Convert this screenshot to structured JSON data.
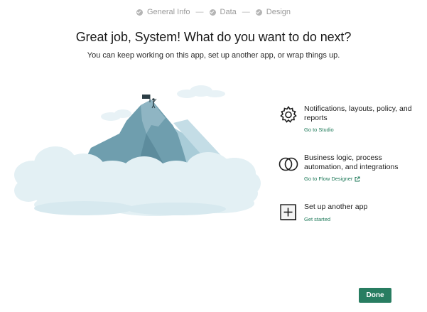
{
  "stepper": {
    "steps": [
      "General Info",
      "Data",
      "Design"
    ],
    "separator": "—"
  },
  "heading": {
    "title": "Great job, System! What do you want to do next?",
    "subtitle": "You can keep working on this app, set up another app, or wrap things up."
  },
  "options": [
    {
      "title": "Notifications, layouts, policy, and reports",
      "link": "Go to Studio",
      "icon": "gear-icon"
    },
    {
      "title": "Business logic, process automation, and integrations",
      "link": "Go to Flow Designer",
      "icon": "overlapping-circles-icon",
      "link_icon": "external-link-icon"
    },
    {
      "title": "Set up another app",
      "link": "Get started",
      "icon": "add-box-icon"
    }
  ],
  "footer": {
    "done_label": "Done"
  },
  "colors": {
    "accent": "#287d61",
    "link": "#1f7a5a",
    "mountain_dark": "#6f9eae",
    "mountain_light": "#a9ccd8",
    "cloud": "#e3f0f4"
  }
}
